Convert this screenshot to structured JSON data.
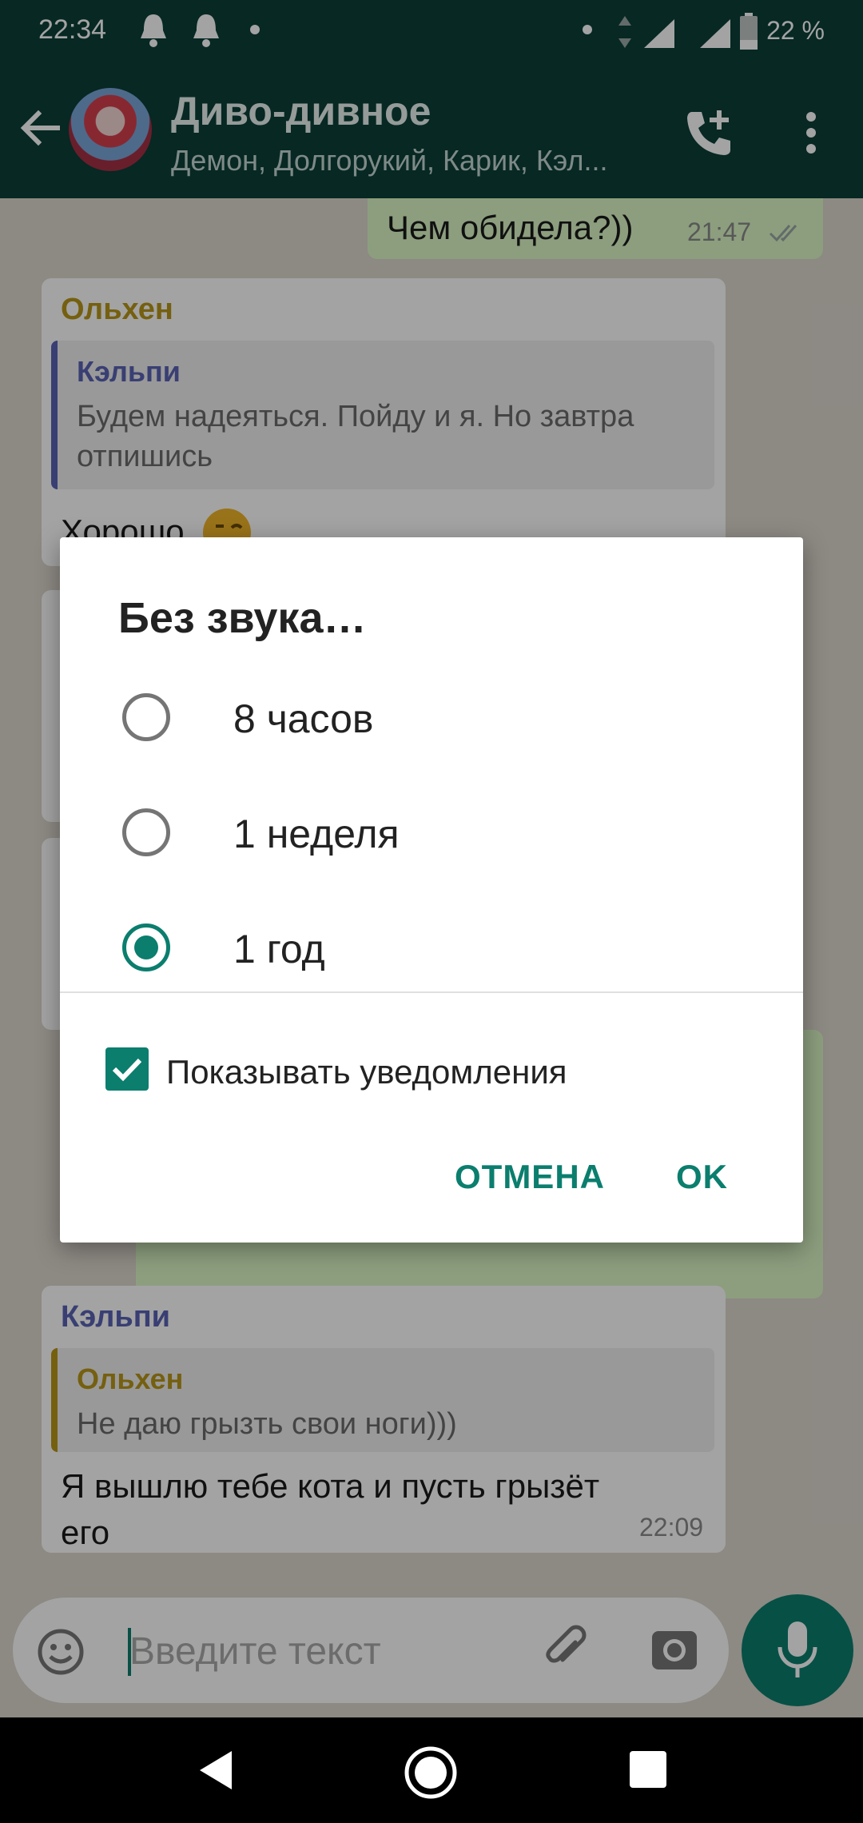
{
  "status_bar": {
    "time": "22:34",
    "battery_percent": "22 %",
    "icons": [
      "notification-bell-icon",
      "notification-bell-icon",
      "dot-icon",
      "dot-icon",
      "data-arrows-icon",
      "signal-icon",
      "signal-icon",
      "battery-icon"
    ]
  },
  "header": {
    "title": "Диво-дивное",
    "subtitle": "Демон, Долгорукий, Карик, Кэл...",
    "icons": [
      "back-arrow-icon",
      "group-avatar",
      "add-call-icon",
      "more-vert-icon"
    ]
  },
  "messages": {
    "top_outgoing": {
      "text": "Чем обидела?))",
      "time": "21:47"
    },
    "first_incoming": {
      "sender": "Ольхен",
      "quote_sender": "Кэльпи",
      "quote_text_line1": "Будем надеяться. Пойду и я. Но завтра",
      "quote_text_line2": "отпишись",
      "text": "Хорошо"
    },
    "last_incoming": {
      "sender": "Кэльпи",
      "quote_sender": "Ольхен",
      "quote_text": "Не даю грызть свои ноги)))",
      "text_line1": "Я вышлю тебе кота и пусть грызёт",
      "text_line2": "его",
      "time": "22:09"
    }
  },
  "composer": {
    "placeholder": "Введите текст",
    "icons": [
      "emoji-icon",
      "attach-icon",
      "camera-icon",
      "mic-icon"
    ]
  },
  "dialog": {
    "title": "Без звука…",
    "options": [
      {
        "label": "8 часов",
        "selected": false
      },
      {
        "label": "1 неделя",
        "selected": false
      },
      {
        "label": "1 год",
        "selected": true
      }
    ],
    "checkbox_label": "Показывать уведомления",
    "checkbox_checked": true,
    "cancel_label": "ОТМЕНА",
    "ok_label": "OK"
  },
  "nav_bar": {
    "icons": [
      "back-triangle-icon",
      "home-circle-icon",
      "recents-square-icon"
    ]
  },
  "colors": {
    "header": "#0b3f37",
    "accent": "#0b7e6e",
    "chat_bg": "#ddd7ce",
    "outgoing_bubble": "#dcf8c6"
  }
}
